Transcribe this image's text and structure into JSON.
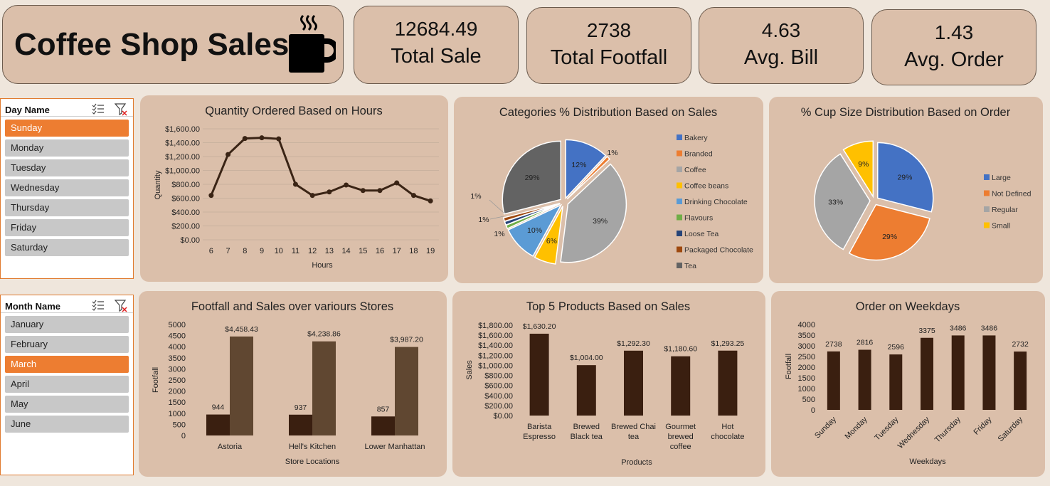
{
  "header": {
    "title": "Coffee Shop Sales",
    "icon": "coffee-mug-icon",
    "kpis": [
      {
        "value": "12684.49",
        "label": "Total Sale"
      },
      {
        "value": "2738",
        "label": "Total Footfall"
      },
      {
        "value": "4.63",
        "label": "Avg. Bill"
      },
      {
        "value": "1.43",
        "label": "Avg. Order"
      }
    ]
  },
  "slicers": {
    "day": {
      "title": "Day Name",
      "items": [
        "Sunday",
        "Monday",
        "Tuesday",
        "Wednesday",
        "Thursday",
        "Friday",
        "Saturday"
      ],
      "selected": "Sunday"
    },
    "month": {
      "title": "Month Name",
      "items": [
        "January",
        "February",
        "March",
        "April",
        "May",
        "June"
      ],
      "selected": "March"
    }
  },
  "colors": {
    "panel_bg": "#dbbfaa",
    "slicer_selected": "#ed7d31",
    "bar_dark": "#3a1f10",
    "bar_light": "#604731"
  },
  "chart_data": [
    {
      "type": "line",
      "title": "Quantity Ordered Based on Hours",
      "xlabel": "Hours",
      "ylabel": "Quantity",
      "x": [
        6,
        7,
        8,
        9,
        10,
        11,
        12,
        13,
        14,
        15,
        16,
        17,
        18,
        19
      ],
      "values": [
        640,
        1230,
        1460,
        1470,
        1455,
        800,
        640,
        690,
        790,
        710,
        710,
        820,
        640,
        560
      ],
      "yticks": [
        "$0.00",
        "$200.00",
        "$400.00",
        "$600.00",
        "$800.00",
        "$1,000.00",
        "$1,200.00",
        "$1,400.00",
        "$1,600.00"
      ],
      "ylim": [
        0,
        1600
      ],
      "grid": true
    },
    {
      "type": "pie",
      "title": "Categories % Distribution Based on Sales",
      "categories": [
        "Bakery",
        "Branded",
        "Coffee",
        "Coffee beans",
        "Drinking Chocolate",
        "Flavours",
        "Loose Tea",
        "Packaged Chocolate",
        "Tea"
      ],
      "values": [
        12,
        1,
        39,
        6,
        10,
        1,
        1,
        1,
        29
      ],
      "labels": [
        "12%",
        "1%",
        "39%",
        "6%",
        "10%",
        "1%",
        "1%",
        "1%",
        "29%"
      ],
      "colors": [
        "#4472c4",
        "#ed7d31",
        "#a5a5a5",
        "#ffc000",
        "#5b9bd5",
        "#70ad47",
        "#264478",
        "#9e480e",
        "#636363"
      ],
      "legend": "right"
    },
    {
      "type": "pie",
      "title": "% Cup Size Distribution Based on Order",
      "categories": [
        "Large",
        "Not Defined",
        "Regular",
        "Small"
      ],
      "values": [
        29,
        29,
        33,
        9
      ],
      "labels": [
        "29%",
        "29%",
        "33%",
        "9%"
      ],
      "colors": [
        "#4472c4",
        "#ed7d31",
        "#a5a5a5",
        "#ffc000"
      ],
      "legend": "right"
    },
    {
      "type": "bar",
      "title": "Footfall and Sales over variours Stores",
      "xlabel": "Store Locations",
      "ylabel": "Footfall",
      "categories": [
        "Astoria",
        "Hell's Kitchen",
        "Lower Manhattan"
      ],
      "series": [
        {
          "values": [
            944,
            937,
            857
          ],
          "labels": [
            "944",
            "937",
            "857"
          ]
        },
        {
          "values": [
            4458.43,
            4238.86,
            3987.2
          ],
          "labels": [
            "$4,458.43",
            "$4,238.86",
            "$3,987.20"
          ]
        }
      ],
      "yticks": [
        "0",
        "500",
        "1000",
        "1500",
        "2000",
        "2500",
        "3000",
        "3500",
        "4000",
        "4500",
        "5000"
      ],
      "ylim": [
        0,
        5000
      ]
    },
    {
      "type": "bar",
      "title": "Top 5 Products Based on Sales",
      "xlabel": "Products",
      "ylabel": "Sales",
      "categories": [
        [
          "Barista",
          "Espresso"
        ],
        [
          "Brewed",
          "Black tea"
        ],
        [
          "Brewed Chai",
          "tea"
        ],
        [
          "Gourmet",
          "brewed",
          "coffee"
        ],
        [
          "Hot",
          "chocolate"
        ]
      ],
      "values": [
        1630.2,
        1004,
        1292.3,
        1180.6,
        1293.25
      ],
      "labels": [
        "$1,630.20",
        "$1,004.00",
        "$1,292.30",
        "$1,180.60",
        "$1,293.25"
      ],
      "yticks": [
        "$0.00",
        "$200.00",
        "$400.00",
        "$600.00",
        "$800.00",
        "$1,000.00",
        "$1,200.00",
        "$1,400.00",
        "$1,600.00",
        "$1,800.00"
      ],
      "ylim": [
        0,
        1800
      ]
    },
    {
      "type": "bar",
      "title": "Order on Weekdays",
      "xlabel": "Weekdays",
      "ylabel": "Footfall",
      "categories": [
        "Sunday",
        "Monday",
        "Tuesday",
        "Wednesday",
        "Thursday",
        "Friday",
        "Saturday"
      ],
      "values": [
        2738,
        2816,
        2596,
        3375,
        3486,
        3486,
        2732
      ],
      "labels": [
        "2738",
        "2816",
        "2596",
        "3375",
        "3486",
        "3486",
        "2732"
      ],
      "yticks": [
        "0",
        "500",
        "1000",
        "1500",
        "2000",
        "2500",
        "3000",
        "3500",
        "4000"
      ],
      "ylim": [
        0,
        4000
      ]
    }
  ]
}
